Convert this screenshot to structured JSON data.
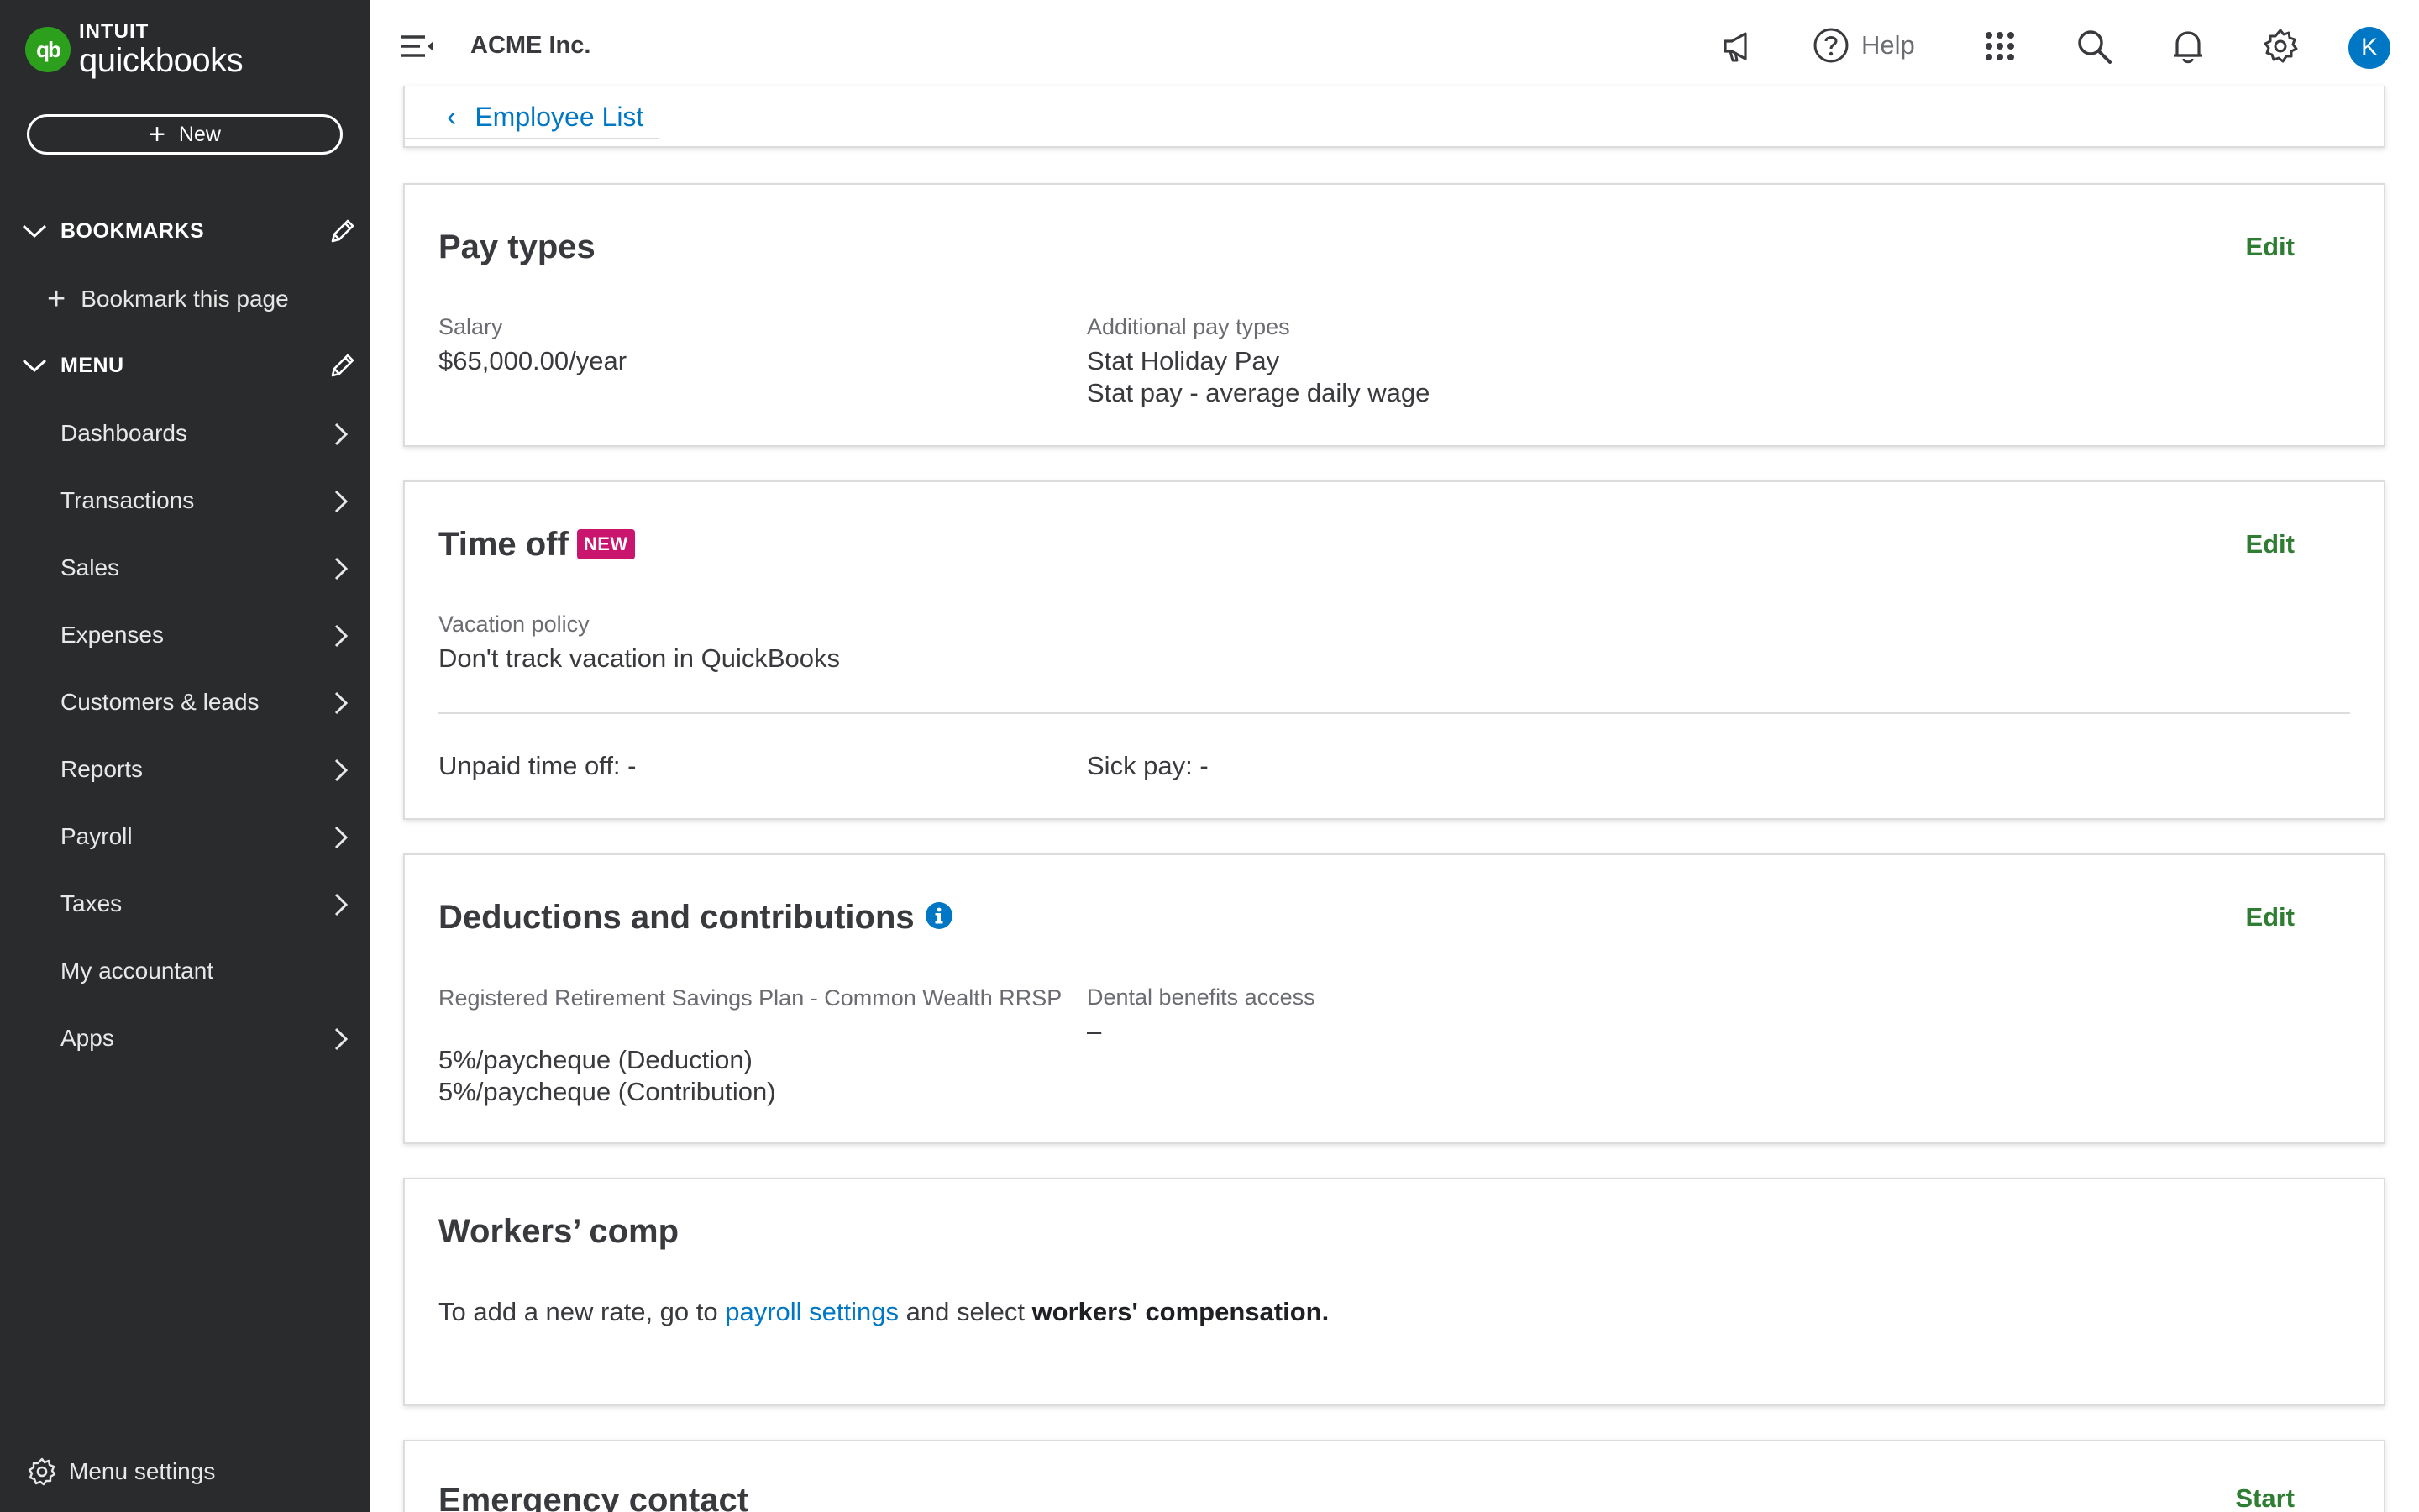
{
  "brand": {
    "intuit": "INTUIT",
    "product": "quickbooks",
    "mark": "qb"
  },
  "sidebar": {
    "new_label": "New",
    "bookmarks_title": "BOOKMARKS",
    "bookmark_add": "Bookmark this page",
    "menu_title": "MENU",
    "items": [
      {
        "label": "Dashboards",
        "has_arrow": true
      },
      {
        "label": "Transactions",
        "has_arrow": true
      },
      {
        "label": "Sales",
        "has_arrow": true
      },
      {
        "label": "Expenses",
        "has_arrow": true
      },
      {
        "label": "Customers & leads",
        "has_arrow": true
      },
      {
        "label": "Reports",
        "has_arrow": true
      },
      {
        "label": "Payroll",
        "has_arrow": true
      },
      {
        "label": "Taxes",
        "has_arrow": true
      },
      {
        "label": "My accountant",
        "has_arrow": false
      },
      {
        "label": "Apps",
        "has_arrow": true
      }
    ],
    "menu_settings": "Menu settings"
  },
  "header": {
    "company": "ACME Inc.",
    "help_label": "Help",
    "avatar_initial": "K",
    "icons": [
      "menu-collapse-icon",
      "megaphone-icon",
      "help-icon",
      "apps-grid-icon",
      "search-icon",
      "bell-icon",
      "gear-icon"
    ]
  },
  "breadcrumb": {
    "label": "Employee List"
  },
  "pay_types": {
    "title": "Pay types",
    "edit": "Edit",
    "salary_label": "Salary",
    "salary_value": "$65,000.00/year",
    "additional_label": "Additional pay types",
    "additional_values": [
      "Stat Holiday Pay",
      "Stat pay - average daily wage"
    ]
  },
  "time_off": {
    "title": "Time off",
    "badge": "NEW",
    "edit": "Edit",
    "vacation_label": "Vacation policy",
    "vacation_value": "Don't track vacation in QuickBooks",
    "unpaid": "Unpaid time off: -",
    "sick": "Sick pay: -"
  },
  "deductions": {
    "title": "Deductions and contributions",
    "edit": "Edit",
    "rrsp_label": "Registered Retirement Savings Plan - Common Wealth RRSP",
    "rrsp_values": [
      "5%/paycheque (Deduction)",
      "5%/paycheque (Contribution)"
    ],
    "dental_label": "Dental benefits access",
    "dental_value": "–"
  },
  "workers_comp": {
    "title": "Workers’ comp",
    "text_before": "To add a new rate, go to ",
    "link": "payroll settings",
    "text_middle": " and select ",
    "text_bold": "workers' compensation."
  },
  "emergency": {
    "title": "Emergency contact",
    "action": "Start"
  },
  "colors": {
    "sidebar_bg": "#2a2b2d",
    "brand_green": "#2ca01c",
    "link_blue": "#0077c5",
    "edit_green": "#2e7d32",
    "badge_magenta": "#c9156e"
  }
}
